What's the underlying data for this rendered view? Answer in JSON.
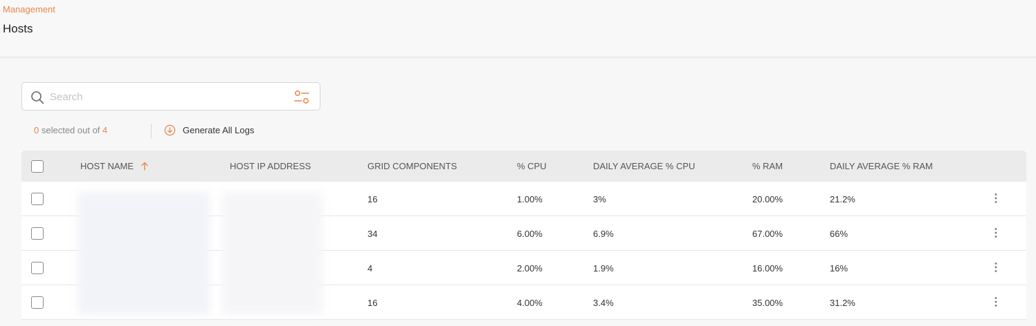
{
  "breadcrumb": "Management",
  "page_title": "Hosts",
  "search": {
    "placeholder": "Search"
  },
  "selection": {
    "selected": "0",
    "text": "selected out of",
    "total": "4"
  },
  "actions": {
    "generate_logs_label": "Generate All Logs"
  },
  "colors": {
    "accent": "#e8854a",
    "header_bg": "#ebebeb"
  },
  "table": {
    "columns": [
      "HOST NAME",
      "HOST IP ADDRESS",
      "GRID COMPONENTS",
      "% CPU",
      "DAILY AVERAGE % CPU",
      "% RAM",
      "DAILY AVERAGE % RAM"
    ],
    "sort_column": "HOST NAME",
    "sort_direction": "ascending",
    "rows": [
      {
        "grid_components": "16",
        "cpu": "1.00%",
        "daily_avg_cpu": "3%",
        "ram": "20.00%",
        "daily_avg_ram": "21.2%"
      },
      {
        "grid_components": "34",
        "cpu": "6.00%",
        "daily_avg_cpu": "6.9%",
        "ram": "67.00%",
        "daily_avg_ram": "66%"
      },
      {
        "grid_components": "4",
        "cpu": "2.00%",
        "daily_avg_cpu": "1.9%",
        "ram": "16.00%",
        "daily_avg_ram": "16%"
      },
      {
        "grid_components": "16",
        "cpu": "4.00%",
        "daily_avg_cpu": "3.4%",
        "ram": "35.00%",
        "daily_avg_ram": "31.2%"
      }
    ]
  },
  "icons": {
    "search": "search-icon",
    "filter": "filter-icon",
    "generate": "download-circle-icon",
    "sort": "arrow-up-icon",
    "row_menu": "kebab-menu-icon"
  }
}
